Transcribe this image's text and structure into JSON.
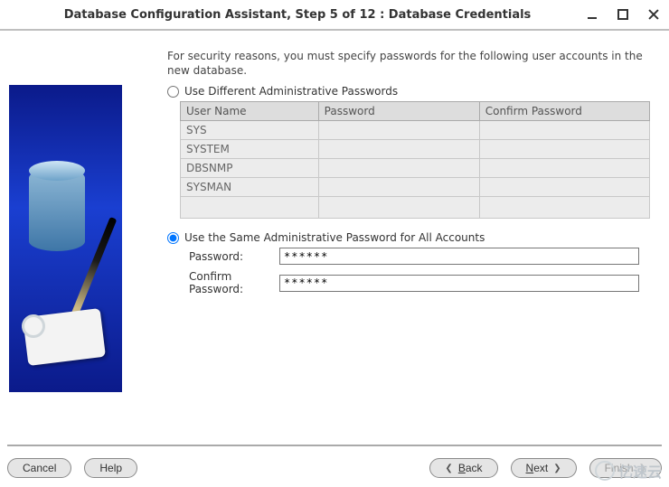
{
  "window": {
    "title": "Database Configuration Assistant, Step 5 of 12 : Database Credentials"
  },
  "intro": "For security reasons, you must specify passwords for the following user accounts in the new database.",
  "options": {
    "different": {
      "label": "Use Different Administrative Passwords",
      "selected": false
    },
    "same": {
      "label": "Use the Same Administrative Password for All Accounts",
      "selected": true
    }
  },
  "table": {
    "headers": {
      "user": "User Name",
      "password": "Password",
      "confirm": "Confirm Password"
    },
    "rows": [
      {
        "user": "SYS",
        "password": "",
        "confirm": ""
      },
      {
        "user": "SYSTEM",
        "password": "",
        "confirm": ""
      },
      {
        "user": "DBSNMP",
        "password": "",
        "confirm": ""
      },
      {
        "user": "SYSMAN",
        "password": "",
        "confirm": ""
      }
    ]
  },
  "fields": {
    "password": {
      "label": "Password:",
      "value": "******"
    },
    "confirm": {
      "label": "Confirm Password:",
      "value": "******"
    }
  },
  "buttons": {
    "cancel": "Cancel",
    "help": "Help",
    "back": "Back",
    "next": "Next",
    "finish": "Finish"
  },
  "underline": {
    "back": "B",
    "next": "N"
  },
  "watermark": "亿速云"
}
